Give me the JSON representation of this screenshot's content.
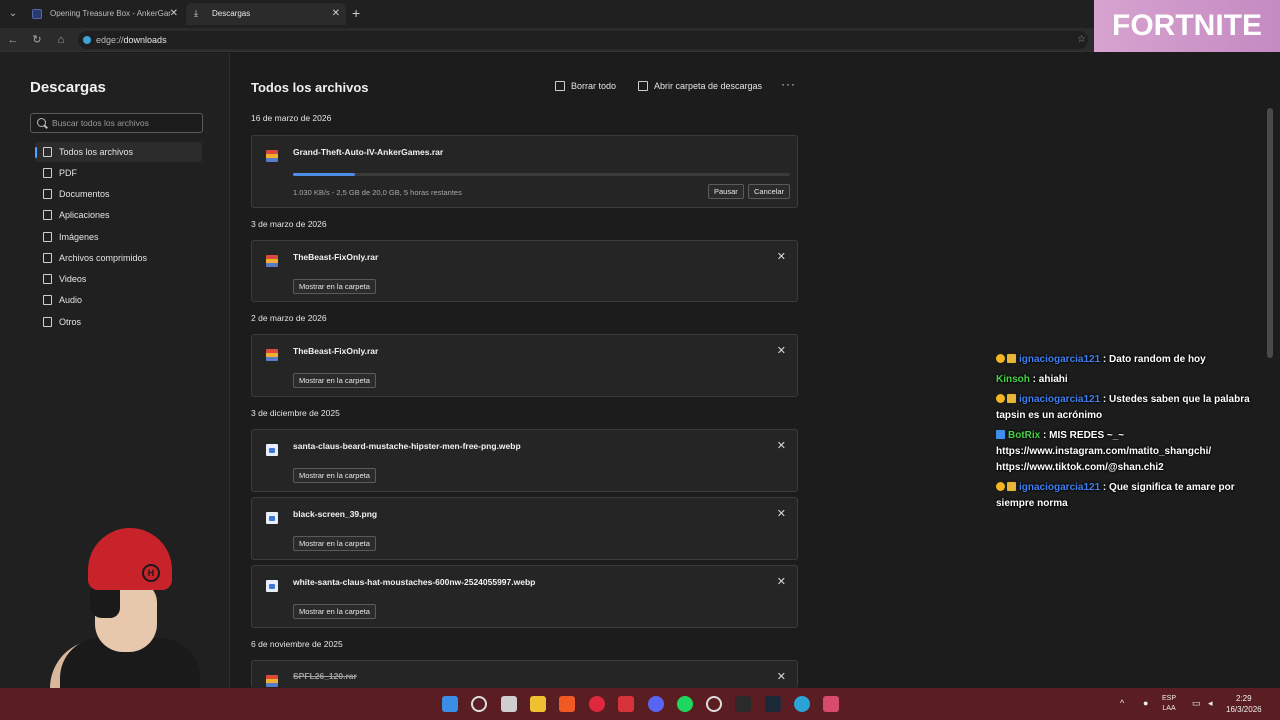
{
  "browser": {
    "tabs": [
      {
        "label": "Opening Treasure Box - AnkerGar"
      },
      {
        "label": "Descargas"
      }
    ],
    "url_scheme": "edge://",
    "url_path": "downloads"
  },
  "overlay": {
    "fortnite_label": "FORTNITE"
  },
  "sidebar": {
    "title": "Descargas",
    "search_placeholder": "Buscar todos los archivos",
    "items": [
      {
        "label": "Todos los archivos"
      },
      {
        "label": "PDF"
      },
      {
        "label": "Documentos"
      },
      {
        "label": "Aplicaciones"
      },
      {
        "label": "Imágenes"
      },
      {
        "label": "Archivos comprimidos"
      },
      {
        "label": "Videos"
      },
      {
        "label": "Audio"
      },
      {
        "label": "Otros"
      }
    ]
  },
  "main": {
    "title": "Todos los archivos",
    "clear_all": "Borrar todo",
    "open_folder": "Abrir carpeta de descargas",
    "more": "···",
    "groups": [
      {
        "date": "16 de marzo de 2026"
      },
      {
        "date": "3 de marzo de 2026"
      },
      {
        "date": "2 de marzo de 2026"
      },
      {
        "date": "3 de diciembre de 2025"
      },
      {
        "date": "6 de noviembre de 2025"
      }
    ],
    "active_download": {
      "name": "Grand-Theft-Auto-IV-AnkerGames.rar",
      "status": "1.030 KB/s - 2,5 GB de 20,0 GB, 5 horas restantes",
      "progress": 0.125,
      "pause": "Pausar",
      "cancel": "Cancelar"
    },
    "files": [
      {
        "name": "TheBeast-FixOnly.rar",
        "button": "Mostrar en la carpeta"
      },
      {
        "name": "TheBeast-FixOnly.rar",
        "button": "Mostrar en la carpeta"
      },
      {
        "name": "santa-claus-beard-mustache-hipster-men-free-png.webp",
        "button": "Mostrar en la carpeta"
      },
      {
        "name": "black-screen_39.png",
        "button": "Mostrar en la carpeta"
      },
      {
        "name": "white-santa-claus-hat-moustaches-600nw-2524055997.webp",
        "button": "Mostrar en la carpeta"
      },
      {
        "name": "SPFL26_120.rar"
      }
    ]
  },
  "chat": [
    {
      "user": "ignaciogarcia121",
      "text": " : Dato random de hoy"
    },
    {
      "user": "Kinsoh",
      "text": " : ahiahi"
    },
    {
      "user": "ignaciogarcia121",
      "text": " : Ustedes saben que la palabra tapsin es un acrónimo"
    },
    {
      "user": "BotRix",
      "text": " : MIS REDES ~_~ https://www.instagram.com/matito_shangchi/ https://www.tiktok.com/@shan.chi2"
    },
    {
      "user": "ignaciogarcia121",
      "text": " : Que significa te amare por siempre norma"
    }
  ],
  "taskbar": {
    "lang_top": "ESP",
    "lang_bottom": "LAA",
    "time": "2:29",
    "date": "16/3/2026"
  }
}
